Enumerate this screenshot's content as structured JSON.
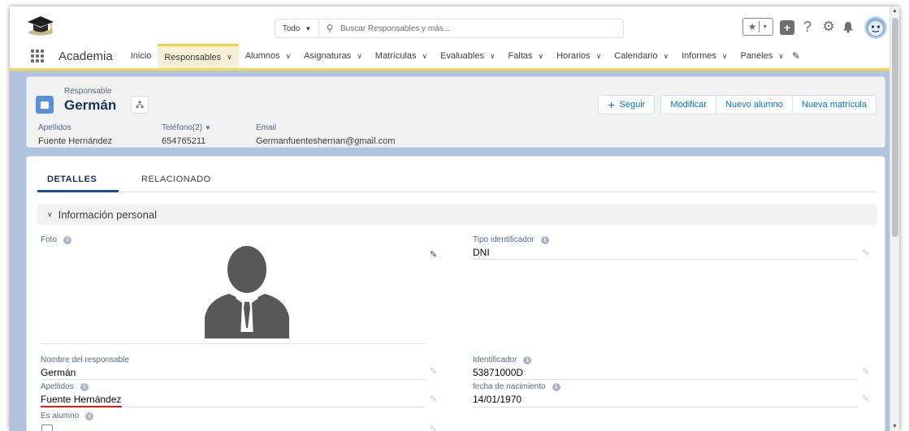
{
  "header": {
    "search_scope": "Todo",
    "search_placeholder": "Buscar Responsables y más..."
  },
  "nav": {
    "app_name": "Academia",
    "items": [
      {
        "label": "Inicio",
        "has_menu": false
      },
      {
        "label": "Responsables",
        "has_menu": true
      },
      {
        "label": "Alumnos",
        "has_menu": true
      },
      {
        "label": "Asignaturas",
        "has_menu": true
      },
      {
        "label": "Matrículas",
        "has_menu": true
      },
      {
        "label": "Evaluables",
        "has_menu": true
      },
      {
        "label": "Faltas",
        "has_menu": true
      },
      {
        "label": "Horarios",
        "has_menu": true
      },
      {
        "label": "Calendario",
        "has_menu": true
      },
      {
        "label": "Informes",
        "has_menu": true
      },
      {
        "label": "Paneles",
        "has_menu": true
      }
    ],
    "active_item": "Responsables"
  },
  "record": {
    "type_label": "Responsable",
    "title": "Germán",
    "buttons": {
      "follow": "Seguir",
      "edit": "Modificar",
      "new_student": "Nuevo alumno",
      "new_enrollment": "Nueva matrícula"
    },
    "highlights": {
      "apellidos_label": "Apellidos",
      "apellidos_value": "Fuente Hernández",
      "telefono_label": "Teléfono(2)",
      "telefono_value": "654765211",
      "email_label": "Email",
      "email_value": "Germanfuenteshernan@gmail.com"
    }
  },
  "tabs": {
    "details": "DETALLES",
    "related": "RELACIONADO",
    "active": "DETALLES"
  },
  "section": {
    "title": "Información personal"
  },
  "fields": {
    "foto_label": "Foto",
    "tipo_identificador_label": "Tipo identificador",
    "tipo_identificador_value": "DNI",
    "nombre_label": "Nombre del responsable",
    "nombre_value": "Germán",
    "identificador_label": "Identificador",
    "identificador_value": "53871000D",
    "apellidos_label": "Apellidos",
    "apellidos_value": "Fuente Hernández",
    "fecha_label": "fecha de nacimiento",
    "fecha_value": "14/01/1970",
    "es_alumno_label": "Es alumno",
    "es_alumno_checked": false
  },
  "colors": {
    "nav_accent": "#f4d94a",
    "background": "#b0c4df",
    "link_blue": "#0070d2",
    "record_icon": "#5a8fdc",
    "highlight_red": "#e01b1b"
  },
  "icons": [
    "app-logo-icon",
    "search-icon",
    "favorites-icon",
    "global-add-icon",
    "help-icon",
    "setup-gear-icon",
    "notification-bell-icon",
    "user-avatar",
    "app-launcher-icon",
    "edit-nav-pencil-icon",
    "record-type-icon",
    "hierarchy-icon",
    "info-icon",
    "edit-pencil-icon",
    "default-person-photo"
  ]
}
